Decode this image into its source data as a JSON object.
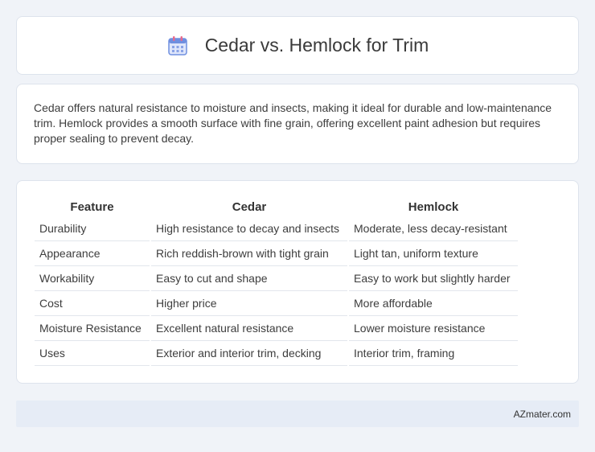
{
  "header": {
    "title": "Cedar vs. Hemlock for Trim",
    "icon": "calendar-icon",
    "colors": {
      "icon_blue": "#6f8fe0",
      "icon_pink": "#e86a8c",
      "icon_body": "#dfe6fb"
    }
  },
  "description": {
    "text": "Cedar offers natural resistance to moisture and insects, making it ideal for durable and low-maintenance trim. Hemlock provides a smooth surface with fine grain, offering excellent paint adhesion but requires proper sealing to prevent decay."
  },
  "table": {
    "headers": [
      "Feature",
      "Cedar",
      "Hemlock"
    ],
    "rows": [
      [
        "Durability",
        "High resistance to decay and insects",
        "Moderate, less decay-resistant"
      ],
      [
        "Appearance",
        "Rich reddish-brown with tight grain",
        "Light tan, uniform texture"
      ],
      [
        "Workability",
        "Easy to cut and shape",
        "Easy to work but slightly harder"
      ],
      [
        "Cost",
        "Higher price",
        "More affordable"
      ],
      [
        "Moisture Resistance",
        "Excellent natural resistance",
        "Lower moisture resistance"
      ],
      [
        "Uses",
        "Exterior and interior trim, decking",
        "Interior trim, framing"
      ]
    ]
  },
  "footer": {
    "text": "AZmater.com"
  }
}
